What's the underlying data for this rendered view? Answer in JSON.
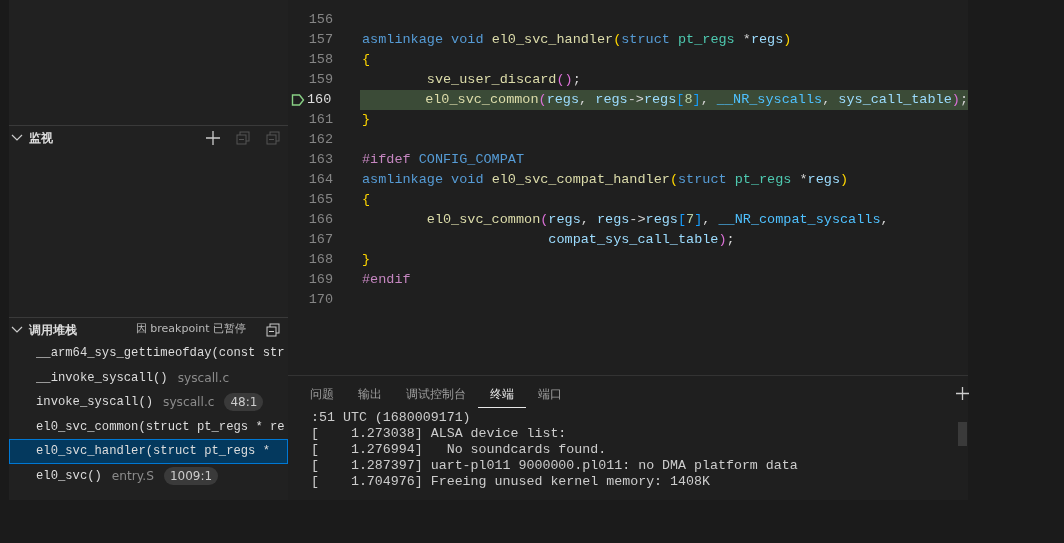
{
  "sidebar": {
    "watch": {
      "title": "监视",
      "expanded": true
    },
    "call_stack": {
      "title": "调用堆栈",
      "expanded": true,
      "status": "因 breakpoint 已暂停",
      "frames": [
        {
          "name": "__arm64_sys_gettimeofday(const str",
          "selected": false
        },
        {
          "name": "__invoke_syscall()",
          "file": "syscall.c",
          "selected": false
        },
        {
          "name": "invoke_syscall()",
          "file": "syscall.c",
          "position": "48:1",
          "selected": false
        },
        {
          "name": "el0_svc_common(struct pt_regs * re",
          "selected": false
        },
        {
          "name": "el0_svc_handler(struct pt_regs *",
          "selected": true
        },
        {
          "name": "el0_svc()",
          "file": "entry.S",
          "position": "1009:1",
          "selected": false
        }
      ]
    }
  },
  "editor": {
    "lines": [
      {
        "number": "156",
        "current": false
      },
      {
        "number": "157",
        "current": false,
        "tokens": [
          {
            "t": "asmlinkage",
            "kind": "kw"
          },
          {
            "t": " void",
            "kind": "kw"
          },
          {
            "t": " el0_svc_handler",
            "kind": "fn"
          },
          {
            "t": "(",
            "kind": "brace"
          },
          {
            "t": "struct",
            "kind": "kw"
          },
          {
            "t": " pt_regs",
            "kind": "type"
          },
          {
            "t": " *",
            "kind": "plain"
          },
          {
            "t": "regs",
            "kind": "param"
          },
          {
            "t": ")",
            "kind": "brace"
          }
        ]
      },
      {
        "number": "158",
        "current": false,
        "tokens": [
          {
            "t": "{",
            "kind": "brace"
          }
        ]
      },
      {
        "number": "159",
        "current": false,
        "tokens": [
          {
            "t": "        sve_user_discard",
            "kind": "fn"
          },
          {
            "t": "()",
            "kind": "paren2"
          },
          {
            "t": ";",
            "kind": "plain"
          }
        ]
      },
      {
        "number": "160",
        "current": true,
        "tokens": [
          {
            "t": "        el0_svc_common",
            "kind": "fn"
          },
          {
            "t": "(",
            "kind": "paren2"
          },
          {
            "t": "regs",
            "kind": "param"
          },
          {
            "t": ", ",
            "kind": "plain"
          },
          {
            "t": "regs",
            "kind": "param"
          },
          {
            "t": "->",
            "kind": "plain"
          },
          {
            "t": "regs",
            "kind": "param"
          },
          {
            "t": "[",
            "kind": "bracket"
          },
          {
            "t": "8",
            "kind": "num"
          },
          {
            "t": "]",
            "kind": "bracket"
          },
          {
            "t": ", ",
            "kind": "plain"
          },
          {
            "t": "__NR_syscalls",
            "kind": "const"
          },
          {
            "t": ", ",
            "kind": "plain"
          },
          {
            "t": "sys_call_table",
            "kind": "param"
          },
          {
            "t": ")",
            "kind": "paren2"
          },
          {
            "t": ";",
            "kind": "plain"
          }
        ]
      },
      {
        "number": "161",
        "current": false,
        "tokens": [
          {
            "t": "}",
            "kind": "brace"
          }
        ]
      },
      {
        "number": "162",
        "current": false
      },
      {
        "number": "163",
        "current": false,
        "tokens": [
          {
            "t": "#ifdef",
            "kind": "macro"
          },
          {
            "t": " CONFIG_COMPAT",
            "kind": "kw"
          }
        ]
      },
      {
        "number": "164",
        "current": false,
        "tokens": [
          {
            "t": "asmlinkage",
            "kind": "kw"
          },
          {
            "t": " void",
            "kind": "kw"
          },
          {
            "t": " el0_svc_compat_handler",
            "kind": "fn"
          },
          {
            "t": "(",
            "kind": "brace"
          },
          {
            "t": "struct",
            "kind": "kw"
          },
          {
            "t": " pt_regs",
            "kind": "type"
          },
          {
            "t": " *",
            "kind": "plain"
          },
          {
            "t": "regs",
            "kind": "param"
          },
          {
            "t": ")",
            "kind": "brace"
          }
        ]
      },
      {
        "number": "165",
        "current": false,
        "tokens": [
          {
            "t": "{",
            "kind": "brace"
          }
        ]
      },
      {
        "number": "166",
        "current": false,
        "tokens": [
          {
            "t": "        el0_svc_common",
            "kind": "fn"
          },
          {
            "t": "(",
            "kind": "paren2"
          },
          {
            "t": "regs",
            "kind": "param"
          },
          {
            "t": ", ",
            "kind": "plain"
          },
          {
            "t": "regs",
            "kind": "param"
          },
          {
            "t": "->",
            "kind": "plain"
          },
          {
            "t": "regs",
            "kind": "param"
          },
          {
            "t": "[",
            "kind": "bracket"
          },
          {
            "t": "7",
            "kind": "num"
          },
          {
            "t": "]",
            "kind": "bracket"
          },
          {
            "t": ", ",
            "kind": "plain"
          },
          {
            "t": "__NR_compat_syscalls",
            "kind": "const"
          },
          {
            "t": ",",
            "kind": "plain"
          }
        ]
      },
      {
        "number": "167",
        "current": false,
        "tokens": [
          {
            "t": "                       compat_sys_call_table",
            "kind": "param"
          },
          {
            "t": ")",
            "kind": "paren2"
          },
          {
            "t": ";",
            "kind": "plain"
          }
        ]
      },
      {
        "number": "168",
        "current": false,
        "tokens": [
          {
            "t": "}",
            "kind": "brace"
          }
        ]
      },
      {
        "number": "169",
        "current": false,
        "tokens": [
          {
            "t": "#endif",
            "kind": "macro"
          }
        ]
      },
      {
        "number": "170",
        "current": false
      }
    ]
  },
  "panel": {
    "tabs": [
      {
        "label": "问题",
        "selected": false
      },
      {
        "label": "输出",
        "selected": false
      },
      {
        "label": "调试控制台",
        "selected": false
      },
      {
        "label": "终端",
        "selected": true
      },
      {
        "label": "端口",
        "selected": false
      }
    ],
    "terminal_lines": [
      ":51 UTC (1680009171)",
      "[    1.273038] ALSA device list:",
      "[    1.276994]   No soundcards found.",
      "[    1.287397] uart-pl011 9000000.pl011: no DMA platform data",
      "[    1.704976] Freeing unused kernel memory: 1408K"
    ]
  }
}
